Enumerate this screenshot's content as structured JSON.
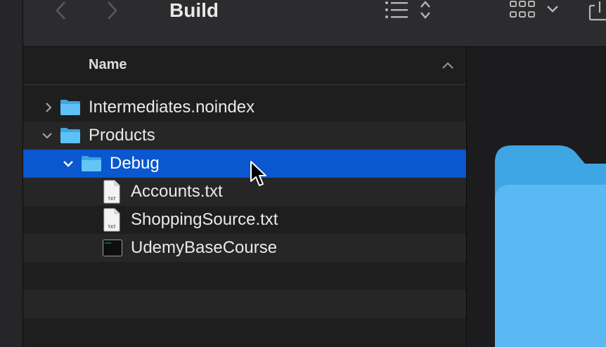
{
  "toolbar": {
    "title": "Build",
    "back_icon": "chevron-left-icon",
    "forward_icon": "chevron-right-icon",
    "list_view_icon": "list-view-icon",
    "sort_icon": "sort-updown-icon",
    "grid_view_icon": "grid-view-icon",
    "share_icon": "share-icon"
  },
  "list": {
    "column_header": "Name",
    "rows": [
      {
        "label": "Intermediates.noindex",
        "kind": "folder",
        "expanded": false
      },
      {
        "label": "Products",
        "kind": "folder",
        "expanded": true
      },
      {
        "label": "Debug",
        "kind": "folder",
        "expanded": true,
        "selected": true
      },
      {
        "label": "Accounts.txt",
        "kind": "text-file",
        "badge": "TXT"
      },
      {
        "label": "ShoppingSource.txt",
        "kind": "text-file",
        "badge": "TXT"
      },
      {
        "label": "UdemyBaseCourse",
        "kind": "executable",
        "badge": "exec"
      }
    ]
  },
  "colors": {
    "selection": "#0a57d0",
    "folder": "#4ab4f0",
    "preview_folder": "#55b8f0"
  }
}
